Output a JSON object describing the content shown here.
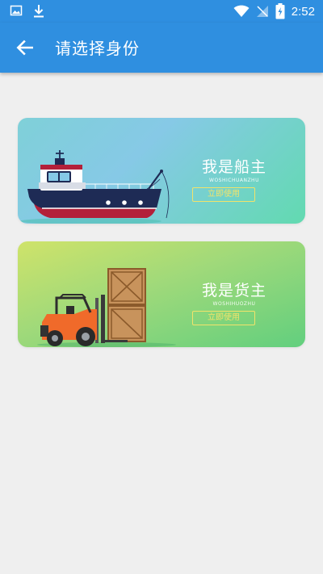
{
  "status_bar": {
    "time": "2:52",
    "left_icons": [
      "image-icon",
      "download-icon"
    ],
    "right_icons": [
      "wifi-icon",
      "no-sim-icon",
      "battery-charging-icon"
    ]
  },
  "app_bar": {
    "title": "请选择身份",
    "back_icon": "arrow-back-icon",
    "color": "#2f8fe0"
  },
  "roles": [
    {
      "title": "我是船主",
      "subtitle": "WOSHICHUANZHU",
      "button": "立即使用",
      "illustration": "ship",
      "gradient": [
        "#7fd0d8",
        "#62dab0"
      ]
    },
    {
      "title": "我是货主",
      "subtitle": "WOSHIHUOZHU",
      "button": "立即使用",
      "illustration": "forklift-with-crates",
      "gradient": [
        "#cfe36a",
        "#62cf7e"
      ]
    }
  ]
}
